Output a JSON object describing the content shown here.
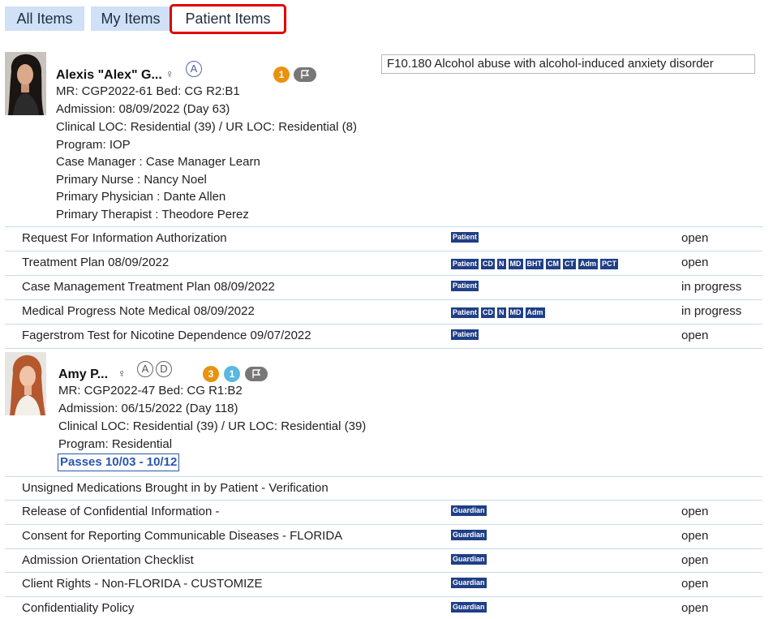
{
  "tabs": [
    {
      "label": "All Items"
    },
    {
      "label": "My Items"
    },
    {
      "label": "Patient Items"
    }
  ],
  "patients": [
    {
      "name": "Alexis \"Alex\" G...",
      "gender_icon": "female-symbol-icon",
      "circle_letters": [
        "A"
      ],
      "badges": [
        {
          "value": "1",
          "color": "#e8920f"
        }
      ],
      "flag_icon": "flag-icon",
      "diagnosis": "F10.180 Alcohol abuse with alcohol-induced anxiety disorder",
      "mr_line": "MR: CGP2022-61    Bed: CG R2:B1",
      "admission": "Admission: 08/09/2022 (Day 63)",
      "loc": "Clinical LOC: Residential (39) / UR LOC: Residential (8)",
      "program": "Program: IOP",
      "case_manager": "Case Manager  :  Case Manager Learn",
      "primary_nurse": "Primary Nurse  :  Nancy Noel",
      "primary_physician": "Primary Physician  :  Dante Allen",
      "primary_therapist": "Primary Therapist  :  Theodore Perez",
      "items": [
        {
          "title": "Request For Information Authorization",
          "tags": [
            "Patient"
          ],
          "status": "open"
        },
        {
          "title": "Treatment Plan 08/09/2022",
          "tags": [
            "Patient",
            "CD",
            "N",
            "MD",
            "BHT",
            "CM",
            "CT",
            "Adm",
            "PCT"
          ],
          "status": "open"
        },
        {
          "title": "Case Management Treatment Plan 08/09/2022",
          "tags": [
            "Patient"
          ],
          "status": "in progress"
        },
        {
          "title": "Medical Progress Note Medical 08/09/2022",
          "tags": [
            "Patient",
            "CD",
            "N",
            "MD",
            "Adm"
          ],
          "status": "in progress"
        },
        {
          "title": "Fagerstrom Test for Nicotine Dependence 09/07/2022",
          "tags": [
            "Patient"
          ],
          "status": "open"
        }
      ]
    },
    {
      "name": "Amy P...",
      "gender_icon": "female-symbol-icon",
      "circle_letters": [
        "A",
        "D"
      ],
      "badges": [
        {
          "value": "3",
          "color": "#e8920f"
        },
        {
          "value": "1",
          "color": "#5ab8e0"
        }
      ],
      "flag_icon": "flag-icon",
      "mr_line": "MR: CGP2022-47    Bed: CG R1:B2",
      "admission": "Admission: 06/15/2022 (Day 118)",
      "loc": "Clinical LOC: Residential (39) / UR LOC: Residential (39)",
      "program": "Program: Residential",
      "passes": "Passes 10/03 - 10/12",
      "items": [
        {
          "title": "Unsigned Medications Brought in by Patient - Verification",
          "tags": [],
          "status": ""
        },
        {
          "title": "Release of Confidential Information -",
          "tags": [
            "Guardian"
          ],
          "status": "open"
        },
        {
          "title": "Consent for Reporting Communicable Diseases - FLORIDA",
          "tags": [
            "Guardian"
          ],
          "status": "open"
        },
        {
          "title": "Admission Orientation Checklist",
          "tags": [
            "Guardian"
          ],
          "status": "open"
        },
        {
          "title": "Client Rights - Non-FLORIDA - CUSTOMIZE",
          "tags": [
            "Guardian"
          ],
          "status": "open"
        },
        {
          "title": "Confidentiality Policy",
          "tags": [
            "Guardian"
          ],
          "status": "open"
        }
      ]
    }
  ]
}
